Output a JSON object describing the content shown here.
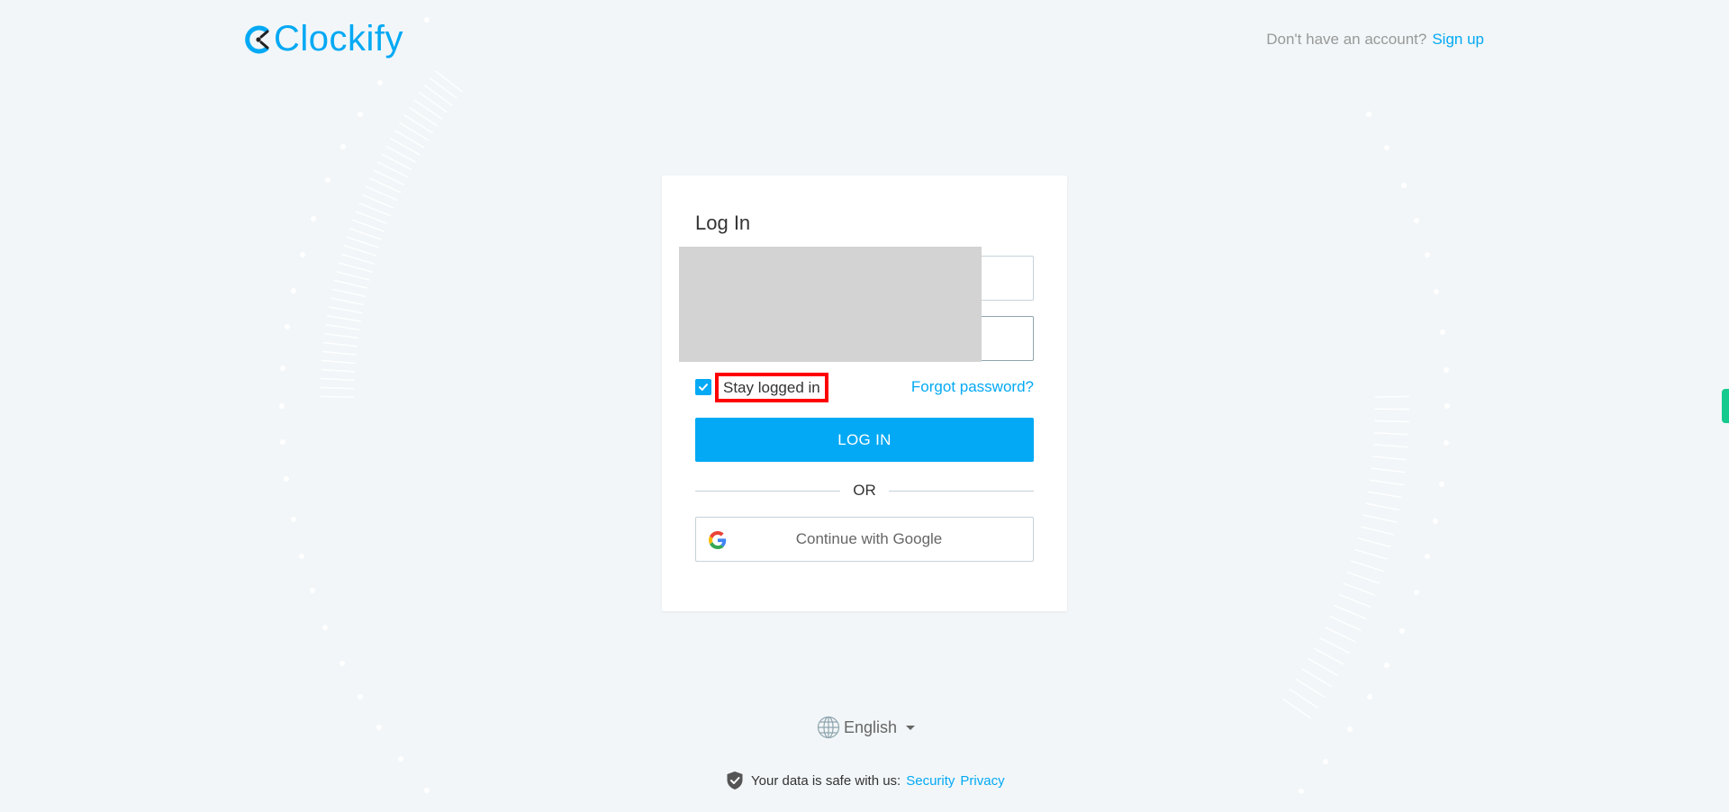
{
  "brand": {
    "name": "Clockify",
    "accent_color": "#03a9f4"
  },
  "header": {
    "signup_prompt": "Don't have an account?",
    "signup_link": "Sign up"
  },
  "login_card": {
    "title": "Log In",
    "email": {
      "value": "",
      "placeholder": ""
    },
    "password": {
      "value": "",
      "placeholder": ""
    },
    "stay_logged_in": {
      "label": "Stay logged in",
      "checked": true
    },
    "forgot_password": "Forgot password?",
    "login_button": "LOG IN",
    "divider_text": "OR",
    "google_button": "Continue with Google"
  },
  "footer": {
    "language": "English",
    "safe_text": "Your data is safe with us:",
    "security_link": "Security",
    "privacy_link": "Privacy"
  },
  "icons": {
    "logo": "clockify-logo-icon",
    "checkbox": "check-icon",
    "google": "google-icon",
    "language": "globe-icon",
    "dropdown": "caret-down-icon",
    "shield": "shield-check-icon"
  }
}
